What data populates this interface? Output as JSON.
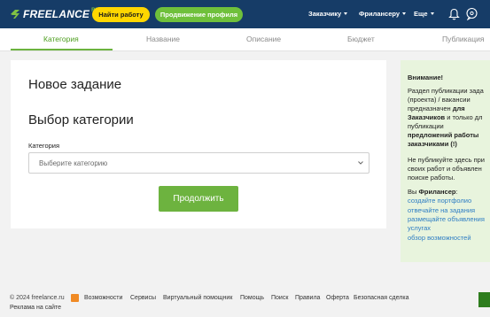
{
  "header": {
    "logo_text": "FREELANCE",
    "logo_ru": "RU",
    "find_work": "Найти работу",
    "promote_profile": "Продвижение профиля",
    "nav": [
      "Заказчику",
      "Фрилансеру",
      "Еще"
    ]
  },
  "steps": [
    "Категория",
    "Название",
    "Описание",
    "Бюджет",
    "Публикация"
  ],
  "main": {
    "title": "Новое задание",
    "section_title": "Выбор категории",
    "category_label": "Категория",
    "category_placeholder": "Выберите категорию",
    "continue": "Продолжить"
  },
  "aside": {
    "attention": "Внимание!",
    "line1": "Раздел публикации зада",
    "line2": "(проекта) / вакансии",
    "line3a": "предназначен ",
    "line3b": "для",
    "line4a": "Заказчиков",
    "line4b": " и только дл",
    "line5": "публикации",
    "line6": "предложений работы",
    "line7": "заказчиками (!)",
    "line8": "Не публикуйте здесь при",
    "line9": "своих работ и объявлен",
    "line10": "поиске работы.",
    "line11a": "Вы ",
    "line11b": "Фрилансер",
    "line11c": ":",
    "links": [
      "создайте портфолио",
      "отвечайте на задания",
      "размещайте объявления",
      "услугах",
      "обзор возможностей"
    ]
  },
  "footer": {
    "copyright": "© 2024 freelance.ru",
    "links": [
      "Возможности",
      "Сервисы",
      "Виртуальный помощник",
      "Помощь",
      "Поиск",
      "Правила",
      "Оферта",
      "Безопасная сделка"
    ],
    "ad": "Реклама на сайте"
  },
  "colors": {
    "topbar": "#163c67",
    "yellow": "#ffd600",
    "green": "#6db33f",
    "aside_bg": "#e8f4dd",
    "link": "#2e7dc4"
  }
}
